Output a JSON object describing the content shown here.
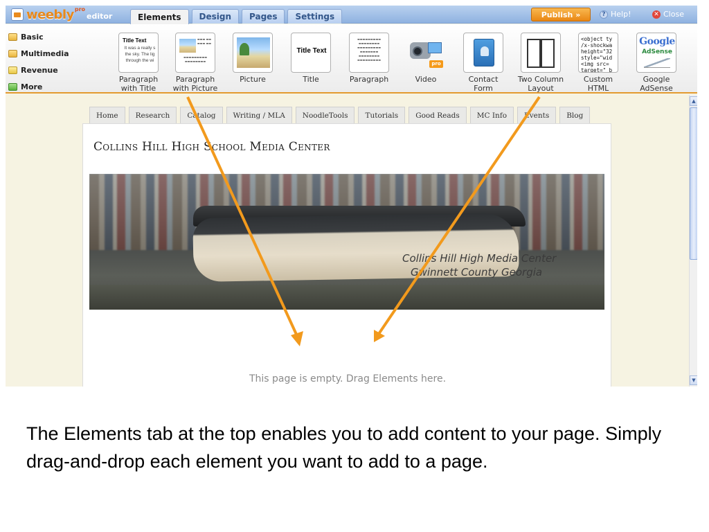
{
  "app": {
    "logo_word": "weebly",
    "logo_badge": "pro",
    "logo_suffix": "editor"
  },
  "tabs": [
    {
      "label": "Elements",
      "active": true
    },
    {
      "label": "Design",
      "active": false
    },
    {
      "label": "Pages",
      "active": false
    },
    {
      "label": "Settings",
      "active": false
    }
  ],
  "topbar": {
    "publish_label": "Publish »",
    "help_label": "Help!",
    "close_label": "Close"
  },
  "categories": [
    {
      "label": "Basic",
      "icon": "folder-icon"
    },
    {
      "label": "Multimedia",
      "icon": "folder-icon"
    },
    {
      "label": "Revenue",
      "icon": "folder-icon"
    },
    {
      "label": "More",
      "icon": "arrow-right-icon"
    }
  ],
  "elements": {
    "paragraph_with_title": {
      "label": "Paragraph\nwith Title",
      "mini_title": "Title Text",
      "mini_text": "It was a really s the sky. The lig through the wi"
    },
    "paragraph_with_picture": {
      "label": "Paragraph\nwith Picture"
    },
    "picture": {
      "label": "Picture"
    },
    "title": {
      "label": "Title",
      "mini_title": "Title Text"
    },
    "paragraph": {
      "label": "Paragraph"
    },
    "video": {
      "label": "Video",
      "badge": "pro"
    },
    "contact_form": {
      "label": "Contact\nForm"
    },
    "two_column": {
      "label": "Two Column\nLayout"
    },
    "custom_html": {
      "label": "Custom\nHTML",
      "code": "<object ty\n/x-shockwa\nheight=\"32\nstyle=\"wid\n<img src=\ntarget=\"_b"
    },
    "google_adsense": {
      "label": "Google\nAdSense",
      "logo": "Google",
      "sub": "AdSense"
    }
  },
  "site_nav": [
    "Home",
    "Research",
    "Catalog",
    "Writing / MLA",
    "NoodleTools",
    "Tutorials",
    "Good Reads",
    "MC Info",
    "Events",
    "Blog"
  ],
  "site": {
    "title": "Collins Hill High School Media Center",
    "image_caption_line1": "Collins Hill High Media Center",
    "image_caption_line2": "Gwinnett County Georgia",
    "empty_note": "This page is empty. Drag Elements here."
  },
  "colors": {
    "arrow": "#f29a1d",
    "publish": "#e98714",
    "toolbar_accent": "#e39a2f"
  },
  "slide_caption": "The Elements tab at the top enables you to add content to your page. Simply drag-and-drop each element you want to add to a page."
}
